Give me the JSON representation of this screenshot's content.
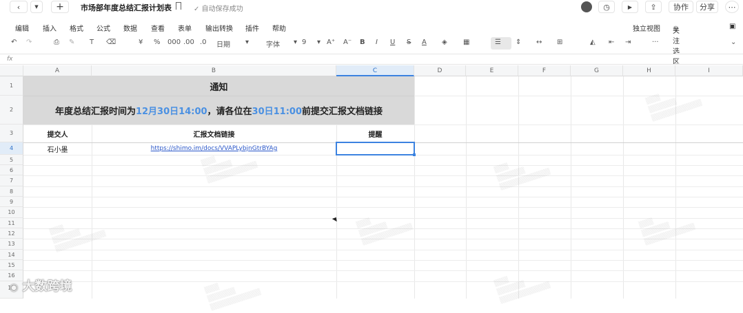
{
  "header": {
    "back_icon": "chevron-left-icon",
    "dropdown_icon": "caret-down-icon",
    "add_icon": "plus-icon",
    "title": "市场部年度总结汇报计划表",
    "bookmark_icon": "bookmark-icon",
    "save_status": "自动保存成功",
    "collab_label": "协作",
    "share_label": "分享"
  },
  "menu": {
    "items": [
      "编辑",
      "插入",
      "格式",
      "公式",
      "数据",
      "查看",
      "表单",
      "输出转换",
      "插件",
      "帮助"
    ],
    "right": [
      "独立视图",
      "关注选区"
    ]
  },
  "toolbar": {
    "currency": "¥",
    "percent": "%",
    "thousands": "000",
    "dec_add": ".00",
    "dec_remove": ".0",
    "date_format": "日期",
    "font": "字体",
    "font_size": "9",
    "bold": "B",
    "italic": "I",
    "underline": "U",
    "strike": "S",
    "text_color": "A",
    "more": "···"
  },
  "formula_bar": {
    "label": "fx"
  },
  "columns": [
    "A",
    "B",
    "C",
    "D",
    "E",
    "F",
    "G",
    "H",
    "I"
  ],
  "rows": [
    "1",
    "2",
    "3",
    "4",
    "5",
    "6",
    "7",
    "8",
    "9",
    "10",
    "11",
    "12",
    "13",
    "14",
    "15",
    "16",
    "17"
  ],
  "sheet": {
    "notice_title": "通知",
    "notice_line": {
      "part1": "年度总结汇报时间为",
      "date1": "12月30日14:00",
      "part2": "，请各位在",
      "date2": "30日11:00",
      "part3": "前提交汇报文档链接"
    },
    "headers": {
      "submitter": "提交人",
      "link": "汇报文档链接",
      "reminder": "提醒"
    },
    "row4": {
      "submitter": "石小墨",
      "link": "https://shimo.im/docs/VVAPLybjnGtrBYAg",
      "reminder": ""
    }
  },
  "branding": {
    "text": "大数跨境"
  }
}
